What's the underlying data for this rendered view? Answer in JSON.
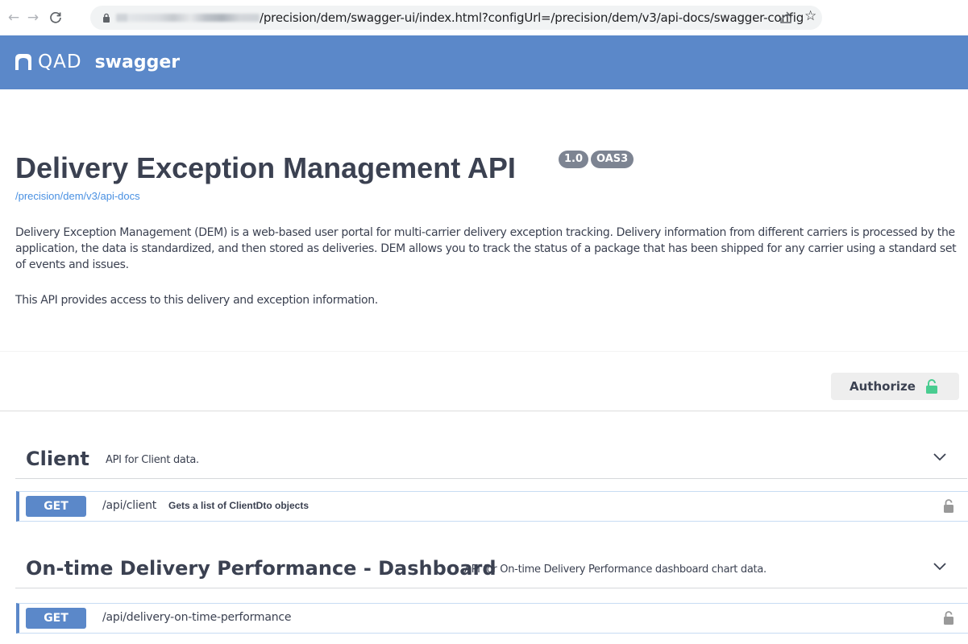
{
  "browser": {
    "url_visible": "/precision/dem/swagger-ui/index.html?configUrl=/precision/dem/v3/api-docs/swagger-config",
    "back_icon": "arrow-left-icon",
    "forward_icon": "arrow-right-icon",
    "reload_icon": "reload-icon"
  },
  "topbar": {
    "brand": "QAD",
    "product": "swagger",
    "color": "#5b88c9"
  },
  "info": {
    "title": "Delivery Exception Management API",
    "version": "1.0",
    "oas": "OAS3",
    "docs_link": "/precision/dem/v3/api-docs",
    "description": "Delivery Exception Management (DEM) is a web-based user portal for multi-carrier delivery exception tracking. Delivery information from different carriers is processed by the application, the data is standardized, and then stored as deliveries. DEM allows you to track the status of a package that has been shipped for any carrier using a standard set of events and issues.",
    "description2": "This API provides access to this delivery and exception information."
  },
  "authorize": {
    "label": "Authorize",
    "lock_color": "#49cc90"
  },
  "tags": [
    {
      "name": "Client",
      "description": "API for Client data.",
      "operations": [
        {
          "method": "GET",
          "path": "/api/client",
          "summary": "Gets a list of ClientDto objects"
        }
      ]
    },
    {
      "name": "On-time Delivery Performance - Dashboard",
      "description": "API for On-time Delivery Performance dashboard chart data.",
      "operations": [
        {
          "method": "GET",
          "path": "/api/delivery-on-time-performance",
          "summary": ""
        }
      ]
    }
  ]
}
